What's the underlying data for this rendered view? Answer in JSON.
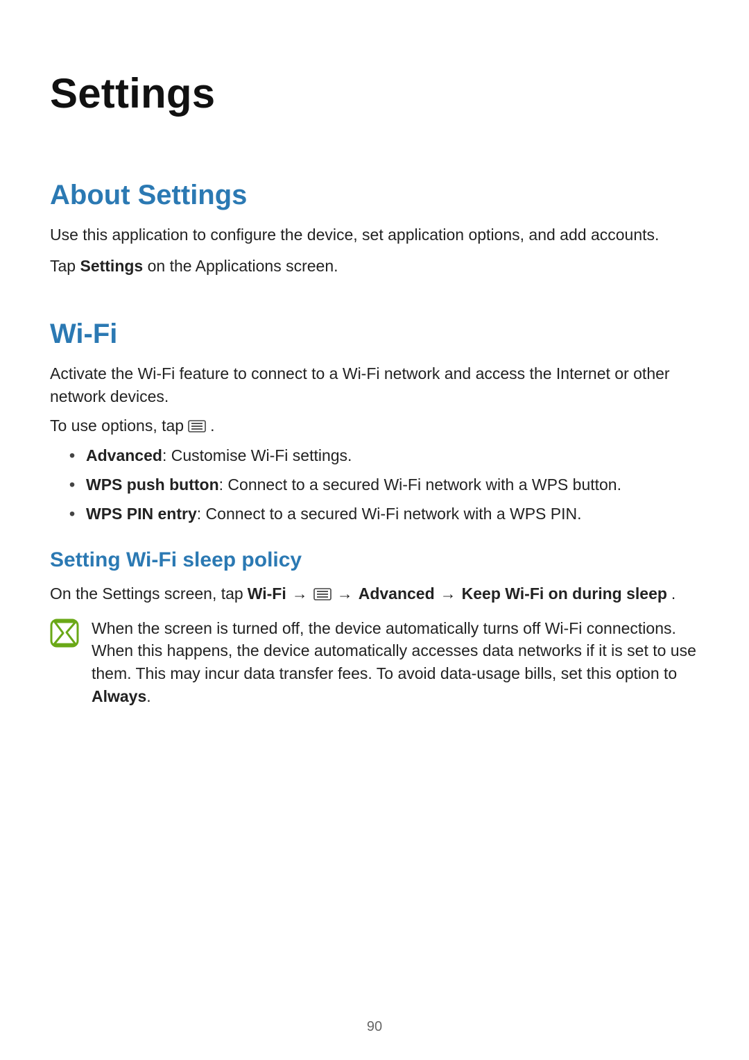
{
  "page_title": "Settings",
  "page_number": "90",
  "sections": {
    "about": {
      "heading": "About Settings",
      "para1": "Use this application to configure the device, set application options, and add accounts.",
      "para2_prefix": "Tap ",
      "para2_bold": "Settings",
      "para2_suffix": " on the Applications screen."
    },
    "wifi": {
      "heading": "Wi-Fi",
      "intro": "Activate the Wi-Fi feature to connect to a Wi-Fi network and access the Internet or other network devices.",
      "options_prefix": "To use options, tap ",
      "options_suffix": ".",
      "bullets": [
        {
          "term": "Advanced",
          "desc": ": Customise Wi-Fi settings."
        },
        {
          "term": "WPS push button",
          "desc": ": Connect to a secured Wi-Fi network with a WPS button."
        },
        {
          "term": "WPS PIN entry",
          "desc": ": Connect to a secured Wi-Fi network with a WPS PIN."
        }
      ],
      "sleep": {
        "heading": "Setting Wi-Fi sleep policy",
        "path_prefix": "On the Settings screen, tap ",
        "step1": "Wi-Fi",
        "arrow": "→",
        "step2": "Advanced",
        "step3": "Keep Wi-Fi on during sleep",
        "path_suffix": ".",
        "note_body": "When the screen is turned off, the device automatically turns off Wi-Fi connections. When this happens, the device automatically accesses data networks if it is set to use them. This may incur data transfer fees. To avoid data-usage bills, set this option to ",
        "note_bold": "Always",
        "note_tail": "."
      }
    }
  }
}
